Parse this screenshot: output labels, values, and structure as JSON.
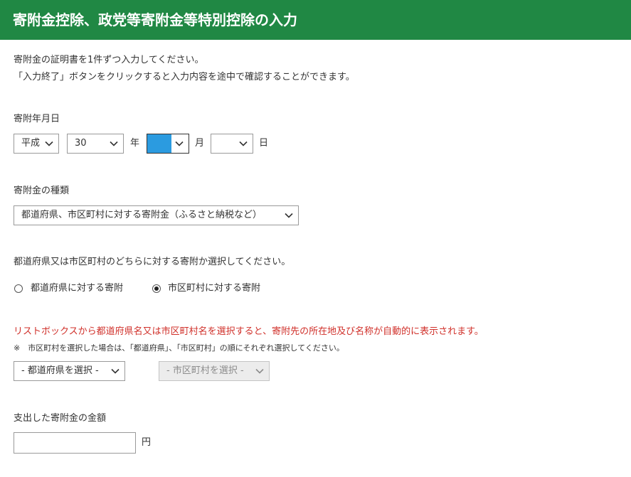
{
  "header": {
    "title": "寄附金控除、政党等寄附金等特別控除の入力"
  },
  "intro": {
    "line1": "寄附金の証明書を1件ずつ入力してください。",
    "line2": "「入力終了」ボタンをクリックすると入力内容を途中で確認することができます。"
  },
  "date": {
    "label": "寄附年月日",
    "era": "平成",
    "year": "30",
    "year_unit": "年",
    "month": "",
    "month_unit": "月",
    "day": "",
    "day_unit": "日"
  },
  "type": {
    "label": "寄附金の種類",
    "selected": "都道府県、市区町村に対する寄附金（ふるさと納税など）"
  },
  "target": {
    "question": "都道府県又は市区町村のどちらに対する寄附か選択してください。",
    "options": [
      {
        "label": "都道府県に対する寄附",
        "checked": false
      },
      {
        "label": "市区町村に対する寄附",
        "checked": true
      }
    ]
  },
  "location": {
    "notice": "リストボックスから都道府県名又は市区町村名を選択すると、寄附先の所在地及び名称が自動的に表示されます。",
    "note": "※　市区町村を選択した場合は、「都道府県」、「市区町村」の順にそれぞれ選択してください。",
    "prefecture_placeholder": "- 都道府県を選択 -",
    "city_placeholder": "- 市区町村を選択 -"
  },
  "amount": {
    "label": "支出した寄附金の金額",
    "value": "",
    "unit": "円"
  },
  "colors": {
    "header_bg": "#208844",
    "notice_text": "#d0302a",
    "month_highlight": "#2b9be0"
  },
  "icons": {
    "select_arrow": "chevron-down-icon"
  }
}
